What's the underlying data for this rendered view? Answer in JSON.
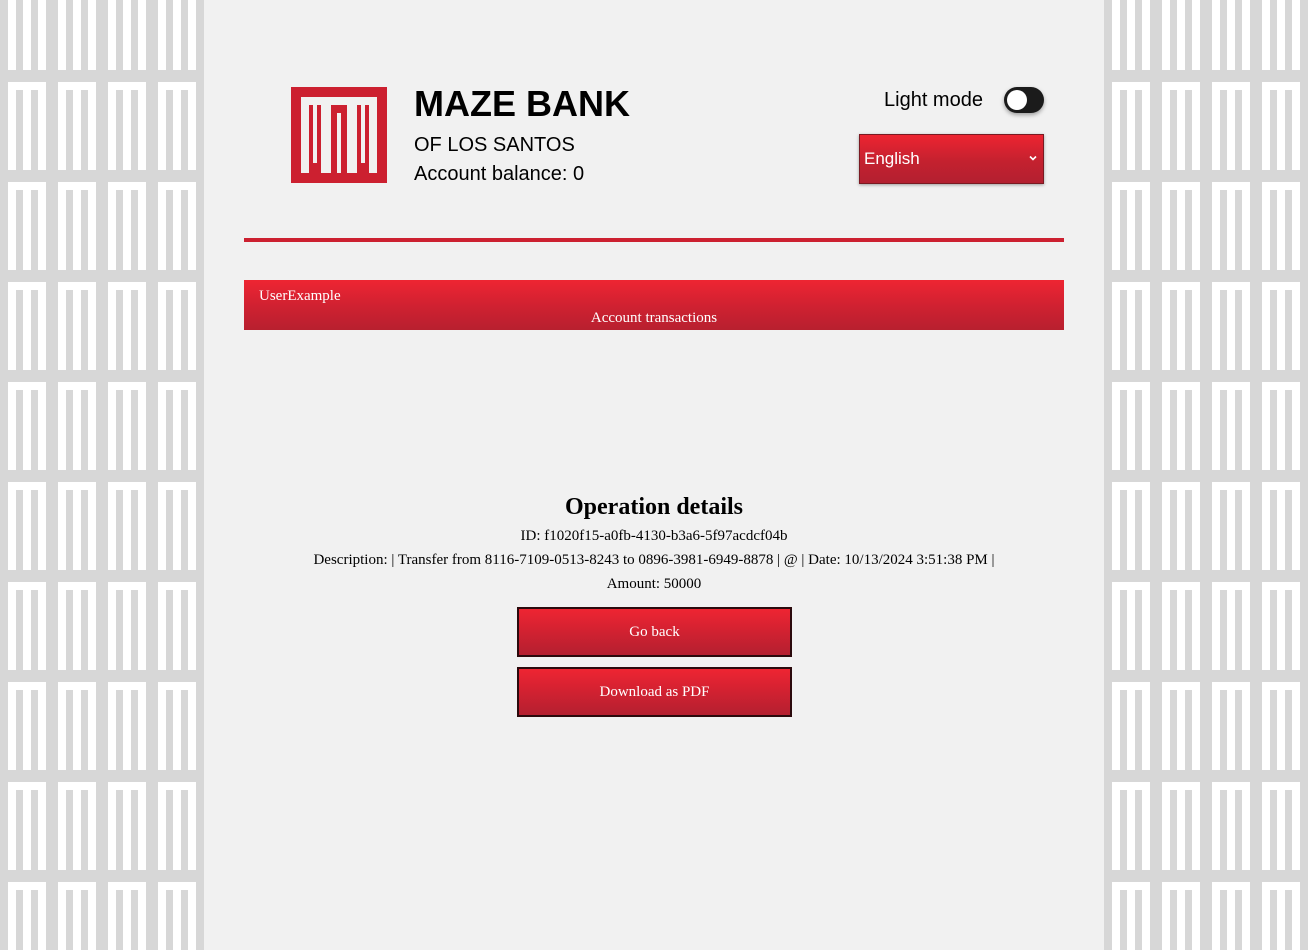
{
  "header": {
    "bank_name": "MAZE BANK",
    "bank_subtitle": "OF LOS SANTOS",
    "balance_label": "Account balance: 0",
    "theme_label": "Light mode",
    "theme_toggle_on": false,
    "language_selected": "English"
  },
  "nav": {
    "username": "UserExample",
    "transactions_link": "Account transactions"
  },
  "operation": {
    "heading": "Operation details",
    "id_line": "ID: f1020f15-a0fb-4130-b3a6-5f97acdcf04b",
    "description_line": "Description: | Transfer from 8116-7109-0513-8243 to 0896-3981-6949-8878 | @ | Date: 10/13/2024 3:51:38 PM |",
    "amount_line": "Amount: 50000"
  },
  "actions": {
    "go_back_label": "Go back",
    "download_pdf_label": "Download as PDF"
  },
  "colors": {
    "brand_red": "#d12131",
    "page_background": "#f1f1f1",
    "pattern_background": "#d4d4d4"
  },
  "icons": {
    "logo": "maze-bank-logo-icon",
    "select_arrow": "chevron-down-icon"
  }
}
